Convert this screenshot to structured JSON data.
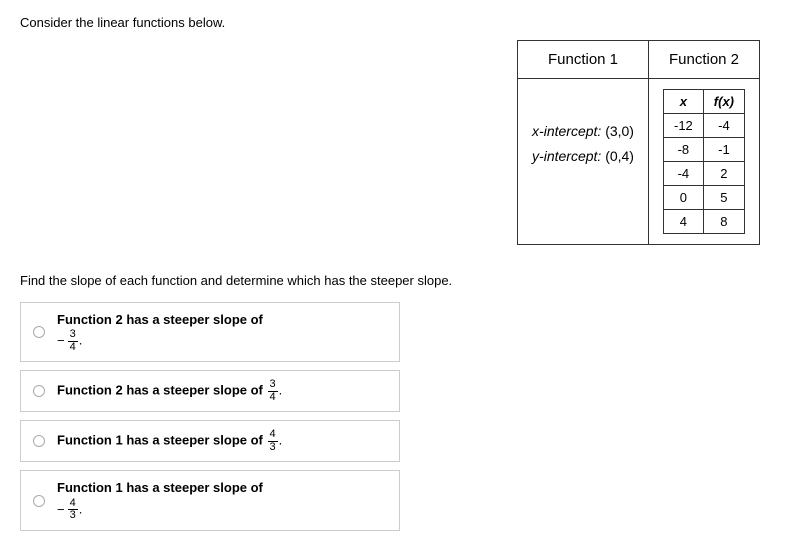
{
  "prompt": "Consider the linear functions below.",
  "table": {
    "headers": [
      "Function 1",
      "Function 2"
    ],
    "function1": {
      "xint_label": "x-intercept:",
      "xint_value": "(3,0)",
      "yint_label": "y-intercept:",
      "yint_value": "(0,4)"
    },
    "function2": {
      "col1_header": "x",
      "col2_header": "f(x)",
      "rows": [
        {
          "x": "-12",
          "fx": "-4"
        },
        {
          "x": "-8",
          "fx": "-1"
        },
        {
          "x": "-4",
          "fx": "2"
        },
        {
          "x": "0",
          "fx": "5"
        },
        {
          "x": "4",
          "fx": "8"
        }
      ]
    }
  },
  "question": "Find the slope of each function and determine which has the steeper slope.",
  "options": [
    {
      "pre": "Function 2 has a steeper slope of",
      "neg": true,
      "num": "3",
      "den": "4",
      "break": true
    },
    {
      "pre": "Function 2 has a steeper slope of",
      "neg": false,
      "num": "3",
      "den": "4",
      "break": false
    },
    {
      "pre": "Function 1 has a steeper slope of",
      "neg": false,
      "num": "4",
      "den": "3",
      "break": false
    },
    {
      "pre": "Function 1 has a steeper slope of",
      "neg": true,
      "num": "4",
      "den": "3",
      "break": true
    }
  ]
}
